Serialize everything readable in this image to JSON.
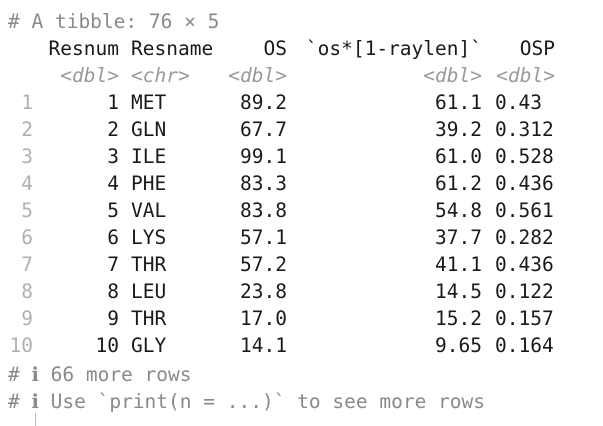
{
  "console": {
    "header": "# A tibble: 76 × 5",
    "columns": [
      {
        "name": "Resnum",
        "type": "<dbl>"
      },
      {
        "name": "Resname",
        "type": "<chr>"
      },
      {
        "name": "OS",
        "type": "<dbl>"
      },
      {
        "name": "`os*[1-raylen]`",
        "type": "<dbl>"
      },
      {
        "name": "OSP",
        "type": "<dbl>"
      }
    ],
    "rows": [
      {
        "idx": "1",
        "resnum": "1",
        "resname": "MET",
        "os": "89.2",
        "os_ray": "61.1",
        "osp": "0.43"
      },
      {
        "idx": "2",
        "resnum": "2",
        "resname": "GLN",
        "os": "67.7",
        "os_ray": "39.2",
        "osp": "0.312"
      },
      {
        "idx": "3",
        "resnum": "3",
        "resname": "ILE",
        "os": "99.1",
        "os_ray": "61.0",
        "osp": "0.528"
      },
      {
        "idx": "4",
        "resnum": "4",
        "resname": "PHE",
        "os": "83.3",
        "os_ray": "61.2",
        "osp": "0.436"
      },
      {
        "idx": "5",
        "resnum": "5",
        "resname": "VAL",
        "os": "83.8",
        "os_ray": "54.8",
        "osp": "0.561"
      },
      {
        "idx": "6",
        "resnum": "6",
        "resname": "LYS",
        "os": "57.1",
        "os_ray": "37.7",
        "osp": "0.282"
      },
      {
        "idx": "7",
        "resnum": "7",
        "resname": "THR",
        "os": "57.2",
        "os_ray": "41.1",
        "osp": "0.436"
      },
      {
        "idx": "8",
        "resnum": "8",
        "resname": "LEU",
        "os": "23.8",
        "os_ray": "14.5",
        "osp": "0.122"
      },
      {
        "idx": "9",
        "resnum": "9",
        "resname": "THR",
        "os": "17.0",
        "os_ray": "15.2",
        "osp": "0.157"
      },
      {
        "idx": "10",
        "resnum": "10",
        "resname": "GLY",
        "os": "14.1",
        "os_ray": "9.65",
        "osp": "0.164"
      }
    ],
    "footer": [
      "# ℹ 66 more rows",
      "# ℹ Use `print(n = ...)` to see more rows"
    ]
  }
}
